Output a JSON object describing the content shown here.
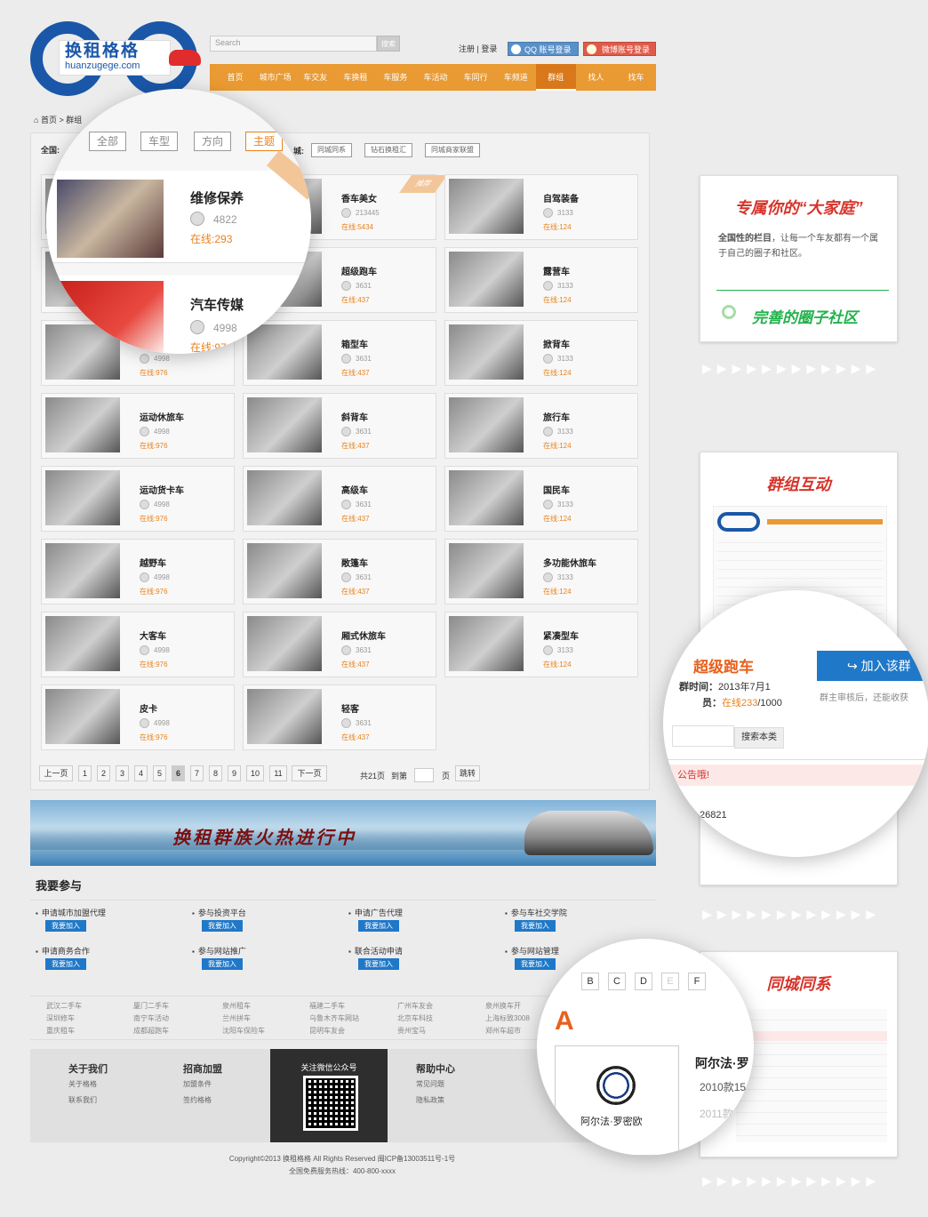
{
  "brand": {
    "name_cn": "换租格格",
    "name_en": "huanzugege.com"
  },
  "search": {
    "placeholder": "Search",
    "button": "搜索"
  },
  "top": {
    "register": "注册",
    "sep": "|",
    "login": "登录",
    "qq": "QQ 账号登录",
    "weibo": "微博账号登录"
  },
  "nav": [
    "首页",
    "城市广场",
    "车交友",
    "车换租",
    "车服务",
    "车活动",
    "车同行",
    "车频道",
    "群组",
    "找人",
    "找车"
  ],
  "nav_active": 8,
  "breadcrumb": {
    "home": "首页",
    "sep": ">",
    "current": "群组"
  },
  "filter": {
    "label": "全国:",
    "city_label": "城:",
    "tags": [
      "同城同系",
      "钻石换租汇",
      "同城商家联盟"
    ]
  },
  "zoom1": {
    "tabs": [
      "全部",
      "车型",
      "方向",
      "主题"
    ],
    "active": 3,
    "items": [
      {
        "name": "维修保养",
        "count": "4822",
        "online_label": "在线:",
        "online": "293"
      },
      {
        "name": "汽车传媒",
        "count": "4998",
        "online_label": "在线:",
        "online": "97"
      }
    ]
  },
  "cards": [
    {
      "name": "维修保养",
      "count": "4822",
      "online": "293"
    },
    {
      "name": "香车美女",
      "count": "213445",
      "online": "5434",
      "tag": "推荐"
    },
    {
      "name": "自驾装备",
      "count": "3133",
      "online": "124"
    },
    {
      "name": "汽车传媒",
      "count": "4998",
      "online": "976"
    },
    {
      "name": "超级跑车",
      "count": "3631",
      "online": "437"
    },
    {
      "name": "露营车",
      "count": "3133",
      "online": "124"
    },
    {
      "name": "",
      "count": "4998",
      "online": "976"
    },
    {
      "name": "箱型车",
      "count": "3631",
      "online": "437"
    },
    {
      "name": "掀背车",
      "count": "3133",
      "online": "124"
    },
    {
      "name": "运动休旅车",
      "count": "4998",
      "online": "976"
    },
    {
      "name": "斜背车",
      "count": "3631",
      "online": "437"
    },
    {
      "name": "旅行车",
      "count": "3133",
      "online": "124"
    },
    {
      "name": "运动货卡车",
      "count": "4998",
      "online": "976"
    },
    {
      "name": "高级车",
      "count": "3631",
      "online": "437"
    },
    {
      "name": "国民车",
      "count": "3133",
      "online": "124"
    },
    {
      "name": "越野车",
      "count": "4998",
      "online": "976"
    },
    {
      "name": "敞篷车",
      "count": "3631",
      "online": "437"
    },
    {
      "name": "多功能休旅车",
      "count": "3133",
      "online": "124"
    },
    {
      "name": "大客车",
      "count": "4998",
      "online": "976"
    },
    {
      "name": "厢式休旅车",
      "count": "3631",
      "online": "437"
    },
    {
      "name": "紧凑型车",
      "count": "3133",
      "online": "124"
    },
    {
      "name": "皮卡",
      "count": "4998",
      "online": "976"
    },
    {
      "name": "轻客",
      "count": "3631",
      "online": "437"
    }
  ],
  "card_online_label": "在线:",
  "card_tag_text": "推荐",
  "pager": {
    "prev": "上一页",
    "pages": [
      "1",
      "2",
      "3",
      "4",
      "5",
      "6",
      "7",
      "8",
      "9",
      "10",
      "11"
    ],
    "current": "6",
    "next": "下一页",
    "total": "共21页",
    "goto": "到第",
    "page_unit": "页",
    "jump": "跳转"
  },
  "banner": {
    "slogan": "换租群族火热进行中"
  },
  "join": {
    "title": "我要参与",
    "btn": "我要加入",
    "items": [
      "申请城市加盟代理",
      "参与投资平台",
      "申请广告代理",
      "参与车社交学院",
      "申请商务合作",
      "参与网站推广",
      "联合活动申请",
      "参与网站管理"
    ]
  },
  "links": [
    "武汉二手车",
    "深圳修车",
    "重庆租车",
    "厦门二手车",
    "南宁车活动",
    "成都超跑车",
    "泉州租车",
    "兰州拼车",
    "沈阳车保险车",
    "福建二手车",
    "乌鲁木齐车网站",
    "昆明车友会",
    "广州车友会",
    "北京车科技",
    "贵州宝马",
    "泉州换车开",
    "上海标致3008",
    "郑州车超市"
  ],
  "footer": {
    "cols": [
      {
        "h": "关于我们",
        "i": [
          "关于格格",
          "联系我们"
        ]
      },
      {
        "h": "招商加盟",
        "i": [
          "加盟条件",
          "签约格格"
        ]
      },
      {
        "h": "帮助中心",
        "i": [
          "常见问题",
          "隐私政策"
        ]
      }
    ],
    "wechat": "关注微信公众号"
  },
  "copyright": "Copyright©2013 换租格格 All Rights Reserved 闽ICP备13003511号-1号",
  "hotline": "全国免费服务热线：400-800-xxxx",
  "side1": {
    "title": "专属你的“大家庭”",
    "desc_bold": "全国性的栏目",
    "desc": "，让每一个车友都有一个属于自己的圈子和社区。",
    "foot": "完善的圈子社区"
  },
  "side2": {
    "title": "群组互动"
  },
  "zoom2": {
    "group": "超级跑车",
    "join": "加入该群",
    "time_label": "群时间：",
    "time": "2013年7月1",
    "members_label": "员：",
    "online_label": "在线",
    "online": "233",
    "total": "/1000",
    "note": "群主审核后，还能收获",
    "search_btn": "搜索本类",
    "notice": "公告哦!",
    "num_label": "：",
    "num": "26821"
  },
  "side3": {
    "title": "同城同系"
  },
  "zoom3": {
    "letters": [
      "B",
      "C",
      "D",
      "E",
      "F"
    ],
    "big_letter": "A",
    "brand": "阿尔法·罗密欧",
    "brand_short": "阿尔法·罗",
    "years": [
      "2010款15",
      "2011款"
    ]
  },
  "colors": {
    "orange": "#e99a32",
    "blue": "#1a57a8",
    "red": "#d6342a",
    "green": "#22b14c"
  }
}
